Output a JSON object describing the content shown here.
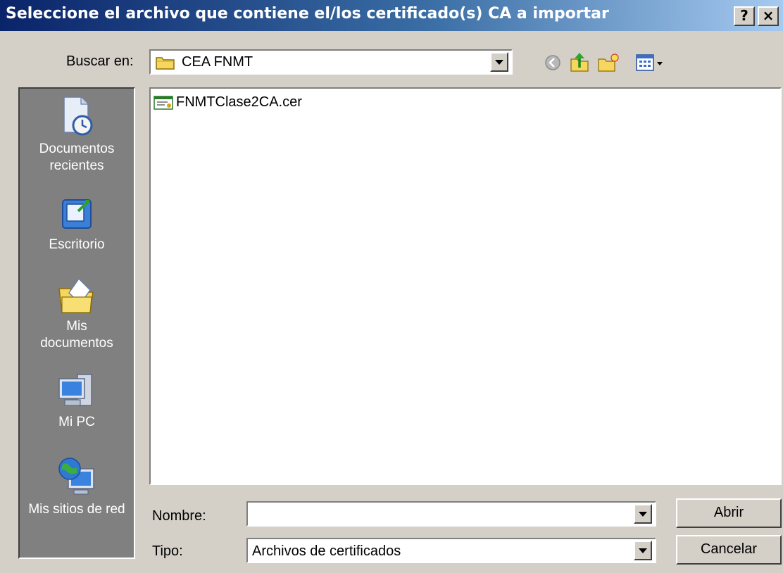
{
  "window": {
    "title": "Seleccione el archivo que contiene el/los certificado(s) CA a importar",
    "help_label": "?",
    "close_label": "×"
  },
  "lookin": {
    "label": "Buscar en:",
    "value": "CEA FNMT"
  },
  "toolbar": {
    "icons": [
      "back-icon",
      "up-folder-icon",
      "new-folder-icon",
      "view-menu-icon"
    ]
  },
  "places": {
    "items": [
      {
        "label_line1": "Documentos",
        "label_line2": "recientes",
        "icon": "recent-documents-icon"
      },
      {
        "label_line1": "Escritorio",
        "label_line2": "",
        "icon": "desktop-icon"
      },
      {
        "label_line1": "Mis",
        "label_line2": "documentos",
        "icon": "my-documents-icon"
      },
      {
        "label_line1": "Mi PC",
        "label_line2": "",
        "icon": "my-computer-icon"
      },
      {
        "label_line1": "Mis sitios de red",
        "label_line2": "",
        "icon": "network-places-icon"
      }
    ]
  },
  "files": [
    {
      "name": "FNMTClase2CA.cer",
      "icon": "certificate-icon"
    }
  ],
  "filename": {
    "label": "Nombre:",
    "value": ""
  },
  "filetype": {
    "label": "Tipo:",
    "value": "Archivos de certificados"
  },
  "buttons": {
    "open": "Abrir",
    "cancel": "Cancelar"
  },
  "colors": {
    "titlebar_start": "#0a246a",
    "titlebar_end": "#a6caf0",
    "face": "#d4d0c8",
    "places_bg": "#808080"
  }
}
